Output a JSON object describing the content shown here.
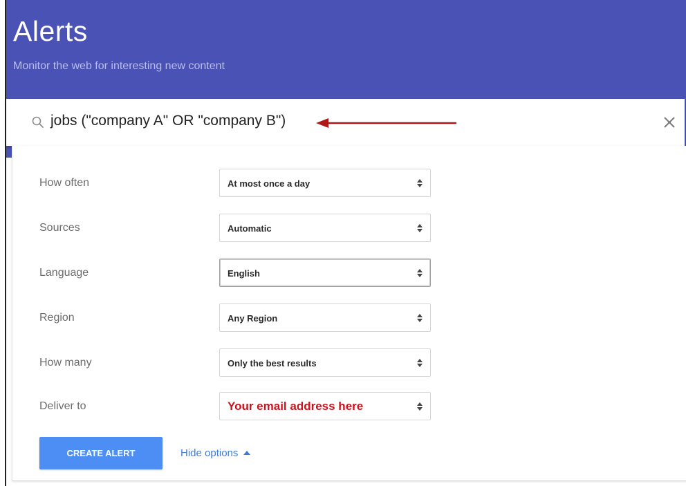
{
  "header": {
    "title": "Alerts",
    "subtitle": "Monitor the web for interesting new content",
    "background_color": "#4a52b5"
  },
  "search": {
    "query": "jobs (\"company A\" OR \"company B\")",
    "icon": "search-icon",
    "clear_icon": "close-icon",
    "annotation_arrow_color": "#b01818"
  },
  "options": [
    {
      "label": "How often",
      "value": "At most once a day"
    },
    {
      "label": "Sources",
      "value": "Automatic"
    },
    {
      "label": "Language",
      "value": "English"
    },
    {
      "label": "Region",
      "value": "Any Region"
    },
    {
      "label": "How many",
      "value": "Only the best results"
    },
    {
      "label": "Deliver to",
      "value": "Your email address here"
    }
  ],
  "actions": {
    "create_label": "CREATE ALERT",
    "hide_options_label": "Hide options",
    "primary_color": "#4d8ef5",
    "link_color": "#3d7be0"
  }
}
